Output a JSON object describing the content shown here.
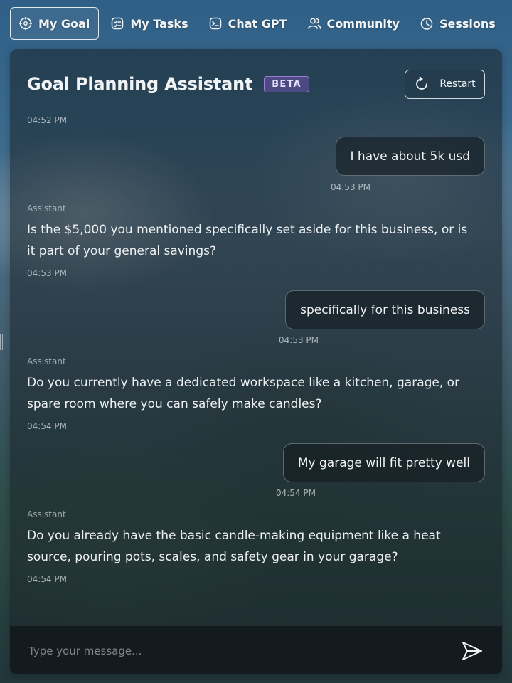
{
  "nav": {
    "items": [
      {
        "label": "My Goal",
        "icon": "target-icon",
        "active": true
      },
      {
        "label": "My Tasks",
        "icon": "tasks-icon",
        "active": false
      },
      {
        "label": "Chat GPT",
        "icon": "terminal-icon",
        "active": false
      },
      {
        "label": "Community",
        "icon": "users-icon",
        "active": false
      },
      {
        "label": "Sessions",
        "icon": "clock-icon",
        "active": false
      }
    ]
  },
  "header": {
    "title": "Goal Planning Assistant",
    "badge": "BETA",
    "restart_label": "Restart",
    "restart_icon": "refresh-icon"
  },
  "chat": {
    "intro_timestamp": "04:52 PM",
    "messages": [
      {
        "role": "user",
        "text": "I have about 5k usd",
        "time": "04:53 PM"
      },
      {
        "role": "assistant",
        "sender": "Assistant",
        "text": "Is the $5,000 you mentioned specifically set aside for this business, or is it part of your general savings?",
        "time": "04:53 PM"
      },
      {
        "role": "user",
        "text": "specifically for this business",
        "time": "04:53 PM"
      },
      {
        "role": "assistant",
        "sender": "Assistant",
        "text": "Do you currently have a dedicated workspace like a kitchen, garage, or spare room where you can safely make candles?",
        "time": "04:54 PM"
      },
      {
        "role": "user",
        "text": "My garage will fit pretty well",
        "time": "04:54 PM"
      },
      {
        "role": "assistant",
        "sender": "Assistant",
        "text": "Do you already have the basic candle-making equipment like a heat source, pouring pots, scales, and safety gear in your garage?",
        "time": "04:54 PM"
      }
    ]
  },
  "input": {
    "placeholder": "Type your message...",
    "value": "",
    "send_icon": "send-icon"
  },
  "colors": {
    "beta_badge_bg": "#6e50aa",
    "panel_bg": "#1a2228"
  }
}
